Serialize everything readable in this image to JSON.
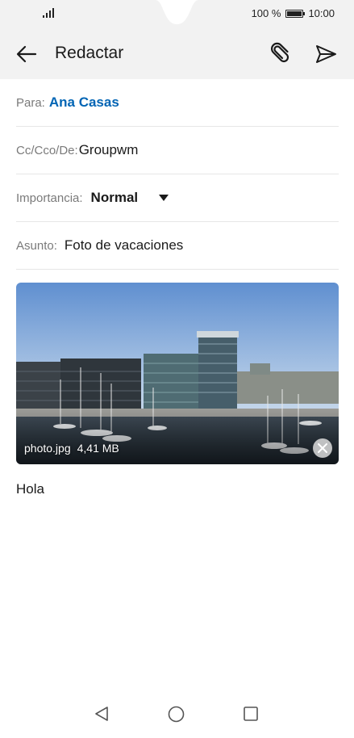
{
  "status": {
    "battery_text": "100 %",
    "time": "10:00",
    "battery_level": 1.0
  },
  "appbar": {
    "title": "Redactar",
    "back_icon": "arrow-left-icon",
    "attach_icon": "paperclip-icon",
    "send_icon": "send-icon"
  },
  "fields": {
    "to_label": "Para:",
    "to_value": "Ana Casas",
    "cc_label": "Cc/Cco/De:",
    "cc_value": "Groupwm",
    "importance_label": "Importancia:",
    "importance_value": "Normal",
    "subject_label": "Asunto:",
    "subject_value": "Foto de vacaciones"
  },
  "attachment": {
    "filename": "photo.jpg",
    "size": "4,41 MB"
  },
  "body": {
    "text": "Hola"
  },
  "colors": {
    "accent": "#0064b4",
    "bar_bg": "#f2f2f2"
  }
}
